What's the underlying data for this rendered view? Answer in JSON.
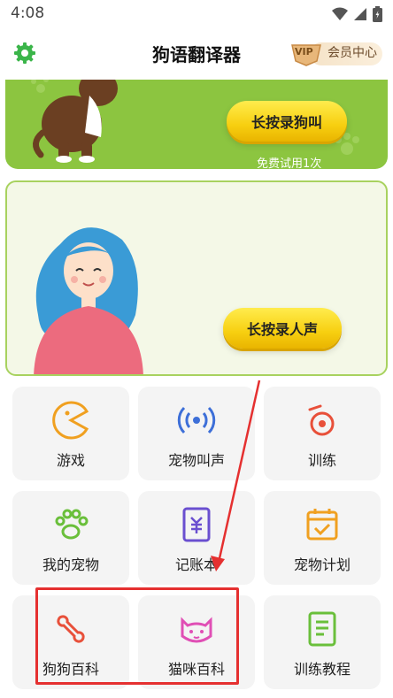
{
  "status_bar": {
    "time": "4:08",
    "icons": [
      "wifi-icon",
      "signal-icon",
      "battery-icon"
    ]
  },
  "header": {
    "title": "狗语翻译器",
    "settings_icon": "gear-icon",
    "vip_badge": "VIP",
    "vip_label": "会员中心"
  },
  "dog_card": {
    "button_label": "长按录狗叫",
    "trial_text": "免费试用1次"
  },
  "human_card": {
    "button_label": "长按录人声"
  },
  "grid": {
    "items": [
      {
        "label": "游戏",
        "icon": "pacman-icon"
      },
      {
        "label": "宠物叫声",
        "icon": "sound-wave-icon"
      },
      {
        "label": "训练",
        "icon": "whistle-icon"
      },
      {
        "label": "我的宠物",
        "icon": "paw-icon"
      },
      {
        "label": "记账本",
        "icon": "ledger-icon"
      },
      {
        "label": "宠物计划",
        "icon": "calendar-check-icon"
      },
      {
        "label": "狗狗百科",
        "icon": "bone-icon"
      },
      {
        "label": "猫咪百科",
        "icon": "cat-face-icon"
      },
      {
        "label": "训练教程",
        "icon": "book-icon"
      }
    ]
  },
  "colors": {
    "accent_green": "#8cc540",
    "button_yellow": "#f7cf10",
    "annotation_red": "#e53030"
  }
}
